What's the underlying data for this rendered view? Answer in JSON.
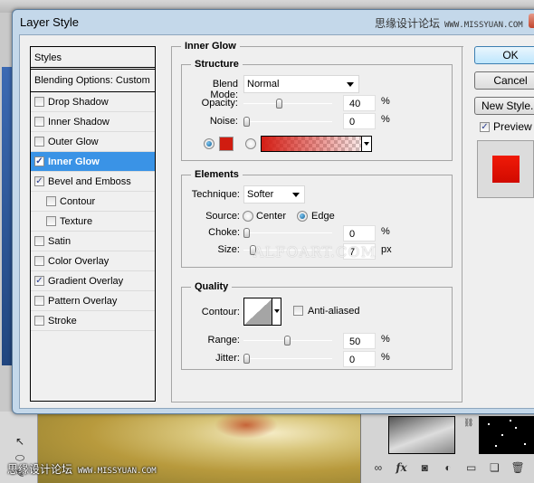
{
  "dialog": {
    "title": "Layer Style",
    "watermark_cn": "思缘设计论坛",
    "watermark_url": "WWW.MISSYUAN.COM"
  },
  "styles_list": {
    "header": "Styles",
    "blending_options": "Blending Options: Custom",
    "items": [
      {
        "label": "Drop Shadow",
        "checked": false,
        "indent": false,
        "selected": false
      },
      {
        "label": "Inner Shadow",
        "checked": false,
        "indent": false,
        "selected": false
      },
      {
        "label": "Outer Glow",
        "checked": false,
        "indent": false,
        "selected": false
      },
      {
        "label": "Inner Glow",
        "checked": true,
        "indent": false,
        "selected": true
      },
      {
        "label": "Bevel and Emboss",
        "checked": true,
        "indent": false,
        "selected": false
      },
      {
        "label": "Contour",
        "checked": false,
        "indent": true,
        "selected": false
      },
      {
        "label": "Texture",
        "checked": false,
        "indent": true,
        "selected": false
      },
      {
        "label": "Satin",
        "checked": false,
        "indent": false,
        "selected": false
      },
      {
        "label": "Color Overlay",
        "checked": false,
        "indent": false,
        "selected": false
      },
      {
        "label": "Gradient Overlay",
        "checked": true,
        "indent": false,
        "selected": false
      },
      {
        "label": "Pattern Overlay",
        "checked": false,
        "indent": false,
        "selected": false
      },
      {
        "label": "Stroke",
        "checked": false,
        "indent": false,
        "selected": false
      }
    ]
  },
  "inner_glow": {
    "title": "Inner Glow",
    "structure": {
      "title": "Structure",
      "blend_mode_label": "Blend Mode:",
      "blend_mode_value": "Normal",
      "opacity_label": "Opacity:",
      "opacity_value": "40",
      "opacity_unit": "%",
      "opacity_percent": 40,
      "noise_label": "Noise:",
      "noise_value": "0",
      "noise_unit": "%",
      "noise_percent": 0,
      "color_mode": "solid",
      "glow_color": "#d01c10"
    },
    "elements": {
      "title": "Elements",
      "technique_label": "Technique:",
      "technique_value": "Softer",
      "source_label": "Source:",
      "source_center": "Center",
      "source_edge": "Edge",
      "source_selected": "Edge",
      "choke_label": "Choke:",
      "choke_value": "0",
      "choke_unit": "%",
      "choke_percent": 0,
      "size_label": "Size:",
      "size_value": "7",
      "size_unit": "px",
      "size_fraction": 0.03
    },
    "quality": {
      "title": "Quality",
      "contour_label": "Contour:",
      "anti_aliased_label": "Anti-aliased",
      "anti_aliased": false,
      "range_label": "Range:",
      "range_value": "50",
      "range_unit": "%",
      "range_percent": 50,
      "jitter_label": "Jitter:",
      "jitter_value": "0",
      "jitter_unit": "%",
      "jitter_percent": 0
    },
    "watermark": "ALFOART.COM"
  },
  "buttons": {
    "ok": "OK",
    "cancel": "Cancel",
    "new_style": "New Style...",
    "preview_label": "Preview",
    "preview_checked": true
  },
  "background_app": {
    "layers_bar_icons": [
      "link-icon",
      "fx-icon",
      "mask-icon",
      "adjustment-icon",
      "folder-icon",
      "new-layer-icon",
      "trash-icon"
    ],
    "watermark_cn": "思缘设计论坛",
    "watermark_url": "WWW.MISSYUAN.COM"
  }
}
